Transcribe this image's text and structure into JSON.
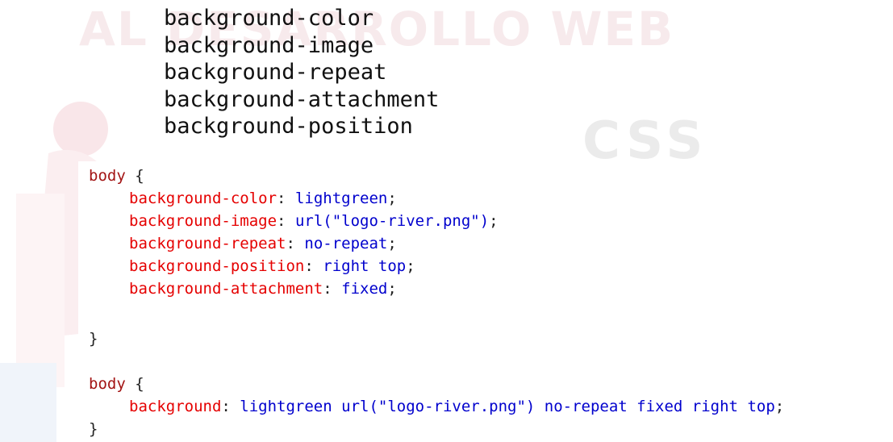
{
  "watermark": {
    "text": "AL DESARROLLO WEB",
    "badge": "CSS"
  },
  "property_list": [
    "background-color",
    "background-image",
    "background-repeat",
    "background-attachment",
    "background-position"
  ],
  "code": {
    "rule1": {
      "selector": "body",
      "open": "{",
      "declarations": [
        {
          "property": "background-color",
          "value": "lightgreen"
        },
        {
          "property": "background-image",
          "value": "url(\"logo-river.png\")"
        },
        {
          "property": "background-repeat",
          "value": "no-repeat"
        },
        {
          "property": "background-position",
          "value": "right top"
        },
        {
          "property": "background-attachment",
          "value": "fixed"
        }
      ],
      "close": "}"
    },
    "rule2": {
      "selector": "body",
      "open": "{",
      "declarations": [
        {
          "property": "background",
          "value": "lightgreen url(\"logo-river.png\") no-repeat fixed right top"
        }
      ],
      "close": "}"
    },
    "colon": ":",
    "semicolon": ";"
  },
  "colors": {
    "selector": "#a31515",
    "property": "#e50000",
    "value": "#0000cd",
    "watermark": "#f7eaec"
  }
}
